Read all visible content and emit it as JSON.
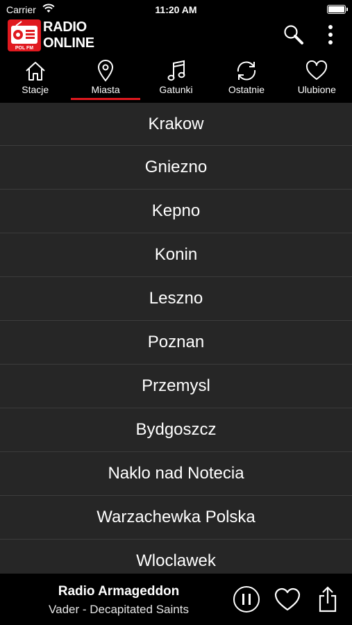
{
  "status_bar": {
    "carrier": "Carrier",
    "time": "11:20 AM"
  },
  "header": {
    "logo_badge": "POL FM",
    "title_line1": "RADIO",
    "title_line2": "ONLINE",
    "accent_color": "#e0191f"
  },
  "tabs": [
    {
      "label": "Stacje",
      "icon": "home-icon",
      "active": false
    },
    {
      "label": "Miasta",
      "icon": "location-pin-icon",
      "active": true
    },
    {
      "label": "Gatunki",
      "icon": "music-note-icon",
      "active": false
    },
    {
      "label": "Ostatnie",
      "icon": "refresh-icon",
      "active": false
    },
    {
      "label": "Ulubione",
      "icon": "heart-icon",
      "active": false
    }
  ],
  "cities": [
    "Krakow",
    "Gniezno",
    "Kepno",
    "Konin",
    "Leszno",
    "Poznan",
    "Przemysl",
    "Bydgoszcz",
    "Naklo nad Notecia",
    "Warzachewka Polska",
    "Wloclawek"
  ],
  "player": {
    "station": "Radio Armageddon",
    "track": "Vader - Decapitated Saints"
  }
}
